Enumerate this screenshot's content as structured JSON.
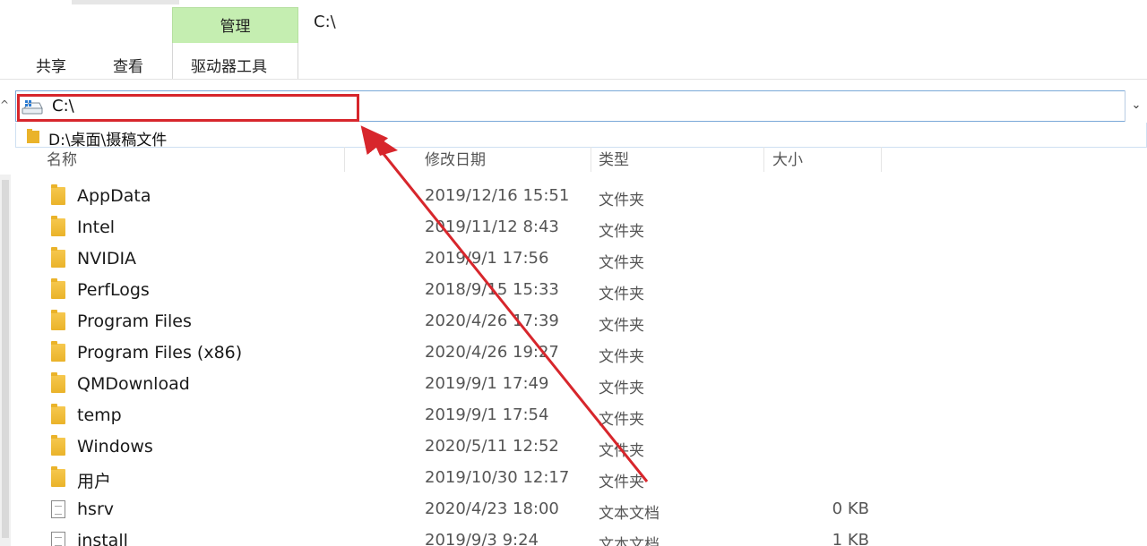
{
  "window": {
    "title": "C:\\"
  },
  "ribbon": {
    "context_group": "管理",
    "tabs": [
      {
        "label": "共享"
      },
      {
        "label": "查看"
      },
      {
        "label": "驱动器工具"
      }
    ]
  },
  "address_bar": {
    "value": "C:\\",
    "dropdown_items": [
      {
        "label": "D:\\桌面\\摄稿文件"
      }
    ],
    "dropdown_icon": "chevron-down-icon"
  },
  "columns": [
    {
      "label": "名称"
    },
    {
      "label": "修改日期"
    },
    {
      "label": "类型"
    },
    {
      "label": "大小"
    }
  ],
  "files": [
    {
      "name": "AppData",
      "date": "2019/12/16 15:51",
      "type": "文件夹",
      "size": "",
      "icon": "folder-icon"
    },
    {
      "name": "Intel",
      "date": "2019/11/12 8:43",
      "type": "文件夹",
      "size": "",
      "icon": "folder-icon"
    },
    {
      "name": "NVIDIA",
      "date": "2019/9/1 17:56",
      "type": "文件夹",
      "size": "",
      "icon": "folder-icon"
    },
    {
      "name": "PerfLogs",
      "date": "2018/9/15 15:33",
      "type": "文件夹",
      "size": "",
      "icon": "folder-icon"
    },
    {
      "name": "Program Files",
      "date": "2020/4/26 17:39",
      "type": "文件夹",
      "size": "",
      "icon": "folder-icon"
    },
    {
      "name": "Program Files (x86)",
      "date": "2020/4/26 19:27",
      "type": "文件夹",
      "size": "",
      "icon": "folder-icon"
    },
    {
      "name": "QMDownload",
      "date": "2019/9/1 17:49",
      "type": "文件夹",
      "size": "",
      "icon": "folder-icon"
    },
    {
      "name": "temp",
      "date": "2019/9/1 17:54",
      "type": "文件夹",
      "size": "",
      "icon": "folder-icon"
    },
    {
      "name": "Windows",
      "date": "2020/5/11 12:52",
      "type": "文件夹",
      "size": "",
      "icon": "folder-icon"
    },
    {
      "name": "用户",
      "date": "2019/10/30 12:17",
      "type": "文件夹",
      "size": "",
      "icon": "folder-icon"
    },
    {
      "name": "hsrv",
      "date": "2020/4/23 18:00",
      "type": "文本文档",
      "size": "0 KB",
      "icon": "text-file-icon"
    },
    {
      "name": "install",
      "date": "2019/9/3 9:24",
      "type": "文本文档",
      "size": "1 KB",
      "icon": "text-file-icon"
    }
  ],
  "annotation": {
    "highlight_color": "#d7262c",
    "arrow_color": "#d7262c"
  }
}
